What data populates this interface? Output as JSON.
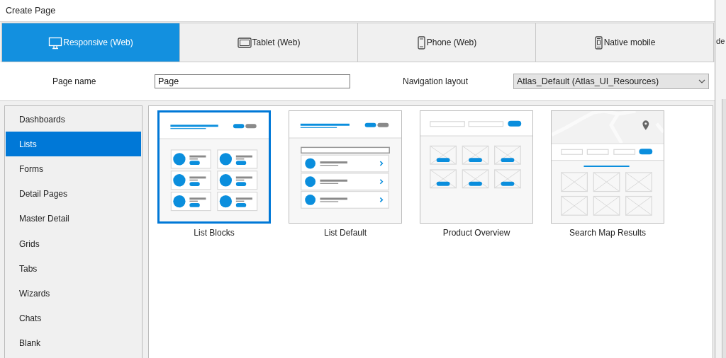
{
  "window": {
    "title": "Create Page"
  },
  "tabs": [
    {
      "label": "Responsive (Web)",
      "kind": "monitor",
      "selected": true
    },
    {
      "label": "Tablet (Web)",
      "kind": "tablet",
      "selected": false
    },
    {
      "label": "Phone (Web)",
      "kind": "phone",
      "selected": false
    },
    {
      "label": "Native mobile",
      "kind": "native",
      "selected": false
    }
  ],
  "form": {
    "page_name_label": "Page name",
    "page_name_value": "Page",
    "navigation_label": "Navigation layout",
    "navigation_value": "Atlas_Default (Atlas_UI_Resources)"
  },
  "sidebar": {
    "items": [
      {
        "label": "Dashboards",
        "selected": false
      },
      {
        "label": "Lists",
        "selected": true
      },
      {
        "label": "Forms",
        "selected": false
      },
      {
        "label": "Detail Pages",
        "selected": false
      },
      {
        "label": "Master Detail",
        "selected": false
      },
      {
        "label": "Grids",
        "selected": false
      },
      {
        "label": "Tabs",
        "selected": false
      },
      {
        "label": "Wizards",
        "selected": false
      },
      {
        "label": "Chats",
        "selected": false
      },
      {
        "label": "Blank",
        "selected": false
      }
    ]
  },
  "templates": [
    {
      "label": "List Blocks",
      "kind": "list-blocks",
      "selected": true
    },
    {
      "label": "List Default",
      "kind": "list-default",
      "selected": false
    },
    {
      "label": "Product Overview",
      "kind": "product-overview",
      "selected": false
    },
    {
      "label": "Search Map Results",
      "kind": "search-map",
      "selected": false
    }
  ],
  "background_window": {
    "text": "de"
  }
}
